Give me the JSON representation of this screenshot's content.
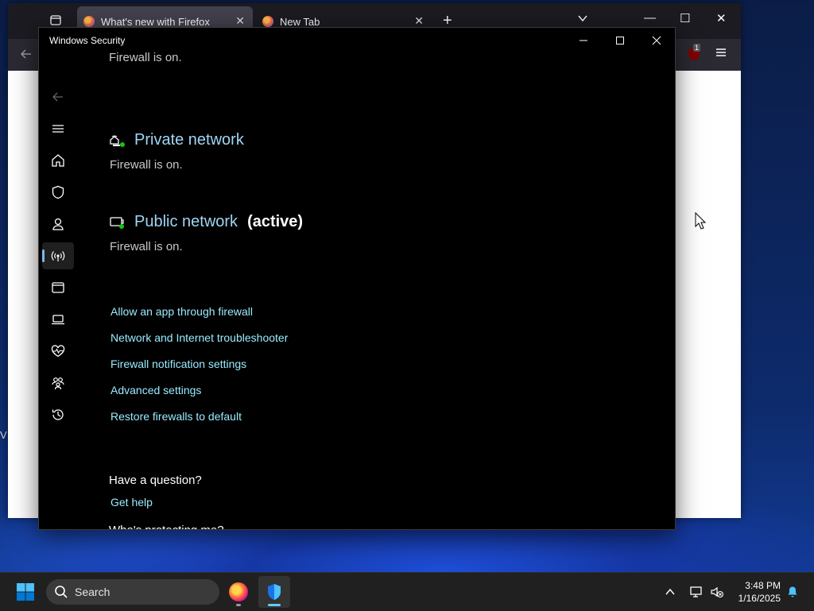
{
  "firefox": {
    "tabs": [
      {
        "title": "What's new with Firefox",
        "active": true
      },
      {
        "title": "New Tab",
        "active": false
      }
    ],
    "new_tab_symbol": "+",
    "extension_badge": "1"
  },
  "desktop": {
    "sliver_text": "V"
  },
  "security": {
    "window_title": "Windows Security",
    "nav_icons": [
      "back-arrow-icon",
      "hamburger-menu-icon",
      "home-icon",
      "shield-icon",
      "account-person-icon",
      "firewall-antenna-icon",
      "app-browser-icon",
      "device-laptop-icon",
      "heart-health-icon",
      "family-icon",
      "history-icon",
      "settings-gear-icon"
    ],
    "domain_status_partial": "Firewall is on.",
    "private": {
      "name": "Private network",
      "status": "Firewall is on."
    },
    "public": {
      "name": "Public network",
      "active_label": "(active)",
      "status": "Firewall is on."
    },
    "links": [
      "Allow an app through firewall",
      "Network and Internet troubleshooter",
      "Firewall notification settings",
      "Advanced settings",
      "Restore firewalls to default"
    ],
    "question_heading": "Have a question?",
    "get_help": "Get help",
    "protecting_heading_partial": "Who's protecting me?"
  },
  "taskbar": {
    "search_placeholder": "Search",
    "time": "3:48 PM",
    "date": "1/16/2025"
  },
  "colors": {
    "accent": "#76b9ed",
    "link": "#99ebff",
    "network_heading": "#9fd5f5",
    "status_green": "#16c60c"
  }
}
